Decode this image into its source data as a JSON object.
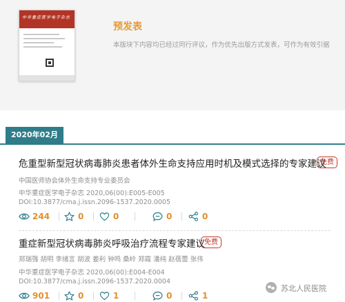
{
  "header": {
    "cover_title": "中华重症医学电子杂志",
    "title": "预发表",
    "description": "本版块下内容均已经过同行评议，作为优先出版方式发表，可作为有效引据"
  },
  "month": {
    "label": "2020年02月"
  },
  "articles": [
    {
      "title": "危重型新型冠状病毒肺炎患者体外生命支持应用时机及模式选择的专家建议",
      "badge": "免费",
      "authors": "中国医师协会体外生命支持专业委员会",
      "journal": "中华重症医学电子杂志 2020,06(00):E005-E005",
      "doi": "DOI:10.3877/cma.j.issn.2096-1537.2020.0005",
      "stats": {
        "views": "244",
        "favorites": "0",
        "likes": "0",
        "comments": "0",
        "shares": "0"
      }
    },
    {
      "title": "重症新型冠状病毒肺炎呼吸治疗流程专家建议",
      "badge": "免费",
      "authors": "郑瑞强 胡明 李绪言 胡波 姜利 钟鸣 桑岭 郑霞 潘纯 赵蓓蕾 张伟",
      "journal": "中华重症医学电子杂志 2020,06(00):E004-E004",
      "doi": "DOI:10.3877/cma.j.issn.2096-1537.2020.0004",
      "stats": {
        "views": "901",
        "favorites": "0",
        "likes": "1",
        "comments": "0",
        "shares": "1"
      }
    }
  ],
  "watermark": {
    "text": "苏北人民医院"
  },
  "colors": {
    "accent": "#e0902e",
    "teal": "#2e7d89",
    "badge": "#c0392b"
  }
}
